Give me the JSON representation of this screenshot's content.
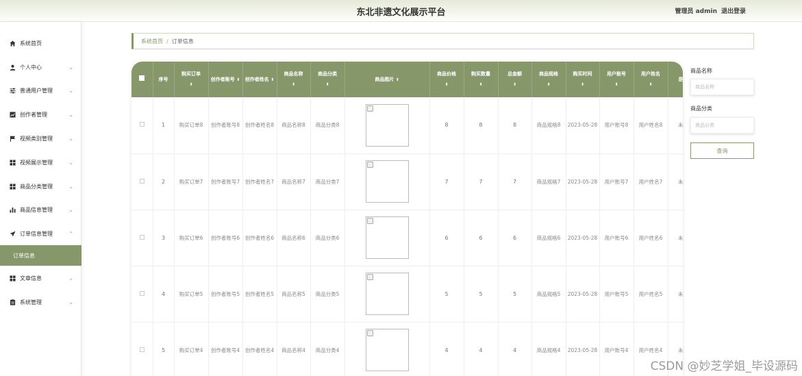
{
  "header": {
    "title": "东北非遗文化展示平台",
    "user": "管理员 admin",
    "logout": "退出登录"
  },
  "sidebar": {
    "items": [
      {
        "label": "系统首页",
        "icon": "home-icon",
        "chev": ""
      },
      {
        "label": "个人中心",
        "icon": "user-icon",
        "chev": "⌄"
      },
      {
        "label": "普通用户管理",
        "icon": "sliders-icon",
        "chev": "⌄"
      },
      {
        "label": "创作者管理",
        "icon": "chart-box-icon",
        "chev": "⌄"
      },
      {
        "label": "视频类别管理",
        "icon": "flag-icon",
        "chev": "⌄"
      },
      {
        "label": "视频展示管理",
        "icon": "grid-icon",
        "chev": "⌄"
      },
      {
        "label": "商品分类管理",
        "icon": "grid-icon",
        "chev": "⌄"
      },
      {
        "label": "商品信息管理",
        "icon": "bar-chart-icon",
        "chev": "⌄"
      },
      {
        "label": "订单信息管理",
        "icon": "send-icon",
        "chev": "⌃"
      },
      {
        "label": "文章信息",
        "icon": "grid-icon",
        "chev": "⌄"
      },
      {
        "label": "系统管理",
        "icon": "clipboard-icon",
        "chev": "⌄"
      }
    ],
    "active_sub": "订单信息"
  },
  "breadcrumb": {
    "home": "系统首页",
    "sep": "/",
    "current": "订单信息"
  },
  "table": {
    "sort_glyph": "⬍",
    "columns": [
      "序号",
      "购买订单",
      "创作者账号",
      "创作者姓名",
      "商品名称",
      "商品分类",
      "商品图片",
      "商品价格",
      "购买数量",
      "总金额",
      "商品规格",
      "购买时间",
      "用户账号",
      "用户姓名",
      "是否"
    ],
    "rows": [
      {
        "no": "1",
        "order": "购买订单8",
        "account": "创作者账号8",
        "name": "创作者姓名8",
        "product": "商品名称8",
        "category": "商品分类8",
        "price": "8",
        "qty": "8",
        "total": "8",
        "spec": "商品规格8",
        "time": "2023-05-28",
        "user_acc": "用户账号8",
        "user_name": "用户姓名8",
        "status": "未支"
      },
      {
        "no": "2",
        "order": "购买订单7",
        "account": "创作者账号7",
        "name": "创作者姓名7",
        "product": "商品名称7",
        "category": "商品分类7",
        "price": "7",
        "qty": "7",
        "total": "7",
        "spec": "商品规格7",
        "time": "2023-05-28",
        "user_acc": "用户账号7",
        "user_name": "用户姓名7",
        "status": "未支"
      },
      {
        "no": "3",
        "order": "购买订单6",
        "account": "创作者账号6",
        "name": "创作者姓名6",
        "product": "商品名称6",
        "category": "商品分类6",
        "price": "6",
        "qty": "6",
        "total": "6",
        "spec": "商品规格6",
        "time": "2023-05-28",
        "user_acc": "用户账号6",
        "user_name": "用户姓名6",
        "status": "未支"
      },
      {
        "no": "4",
        "order": "购买订单5",
        "account": "创作者账号5",
        "name": "创作者姓名5",
        "product": "商品名称5",
        "category": "商品分类5",
        "price": "5",
        "qty": "5",
        "total": "5",
        "spec": "商品规格5",
        "time": "2023-05-28",
        "user_acc": "用户账号5",
        "user_name": "用户姓名5",
        "status": "未支"
      },
      {
        "no": "5",
        "order": "购买订单4",
        "account": "创作者账号4",
        "name": "创作者姓名4",
        "product": "商品名称4",
        "category": "商品分类4",
        "price": "4",
        "qty": "4",
        "total": "4",
        "spec": "商品规格4",
        "time": "2023-05-28",
        "user_acc": "用户账号4",
        "user_name": "用户姓名4",
        "status": "未支"
      }
    ]
  },
  "filter": {
    "name_label": "商品名称",
    "name_placeholder": "商品名称",
    "category_label": "商品分类",
    "category_placeholder": "商品分类",
    "search_button": "查询"
  },
  "watermark": "CSDN @妙芝学姐_毕设源码",
  "colors": {
    "accent": "#86976a"
  }
}
